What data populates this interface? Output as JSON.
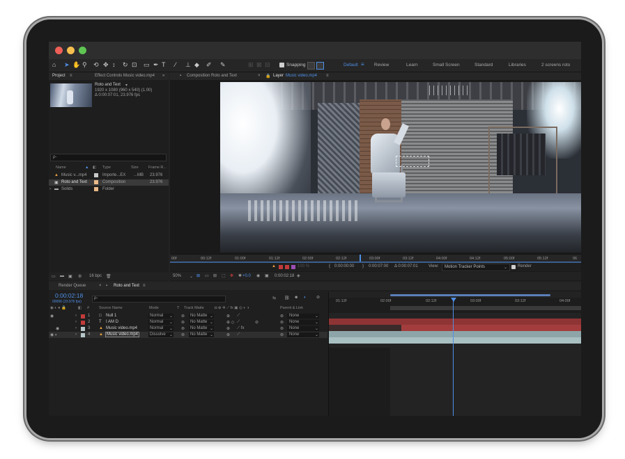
{
  "toolbar": {
    "snapping_label": "Snapping",
    "workspaces": [
      "Default",
      "Review",
      "Learn",
      "Small Screen",
      "Standard",
      "Libraries",
      "2 screens roto"
    ]
  },
  "project_panel": {
    "tab_project": "Project",
    "tab_effects": "Effect Controls Music video.mp4",
    "preview_name": "Roto and Text",
    "preview_info_1": "1920 x 1080 (960 x 540) (1.00)",
    "preview_info_2": "Δ 0:00:07:01, 23.976 fps",
    "search_placeholder": "ρ-",
    "columns": {
      "name": "Name",
      "type": "Type",
      "size": "Size",
      "frame_rate": "Frame R..."
    },
    "items": [
      {
        "name": "Music v...mp4",
        "type": "Importe...EX",
        "size": "...MB",
        "frame_rate": "23.976",
        "color": "#c9c9c9"
      },
      {
        "name": "Roto and Text",
        "type": "Composition",
        "size": "",
        "frame_rate": "23.976",
        "color": "#e8b98a"
      },
      {
        "name": "Solids",
        "type": "Folder",
        "size": "",
        "frame_rate": "",
        "color": "#e8b98a"
      }
    ],
    "bpc": "16 bpc"
  },
  "viewer": {
    "tab_composition": "Composition Roto and Text",
    "tab_layer": "Layer",
    "tab_layer_name": "Music video.mp4",
    "ruler_labels": [
      "00f",
      "00:12f",
      "01:00f",
      "01:12f",
      "02:00f",
      "02:12f",
      "03:00f",
      "03:12f",
      "04:00f",
      "04:12f",
      "05:00f",
      "05:12f",
      "06"
    ],
    "controls": {
      "time_in": "0:00:00:00",
      "time_out": "0:00:07:00",
      "duration": "Δ 0:00:07:01",
      "view_label": "View:",
      "view_value": "Motion Tracker Points",
      "render_label": "Render",
      "zoom": "100 %"
    },
    "footer": {
      "zoom": "50%",
      "exposure": "+0.0",
      "timecode": "0:00:02:18"
    }
  },
  "timeline": {
    "tab_render_queue": "Render Queue",
    "tab_comp": "Roto and Text",
    "timecode": "0:00:02:18",
    "timecode_sub": "00066 (23.976 fps)",
    "columns": {
      "source_name": "Source Name",
      "mode": "Mode",
      "t": "T",
      "track_matte": "Track Matte",
      "parent": "Parent & Link"
    },
    "layers": [
      {
        "num": "1",
        "name": "Null 1",
        "mode": "Normal",
        "matte": "No Matte",
        "parent": "None",
        "label_color": "#c23b3b"
      },
      {
        "num": "2",
        "name": "I AM D",
        "mode": "Normal",
        "matte": "No Matte",
        "parent": "None",
        "label_color": "#c23b3b"
      },
      {
        "num": "3",
        "name": "Music video.mp4",
        "mode": "Normal",
        "matte": "No Matte",
        "parent": "None",
        "label_color": "#b7c7c9"
      },
      {
        "num": "4",
        "name": "Music video.mp4",
        "mode": "Dissolve",
        "matte": "No Matte",
        "parent": "None",
        "label_color": "#b7c7c9"
      }
    ],
    "ruler_labels": [
      "01:12f",
      "02:00f",
      "02:12f",
      "03:00f",
      "03:12f",
      "04:00f"
    ]
  },
  "colors": {
    "accent": "#4f8fe6",
    "layer_red": "#a33d3d",
    "layer_teal": "#9fb8bb"
  }
}
